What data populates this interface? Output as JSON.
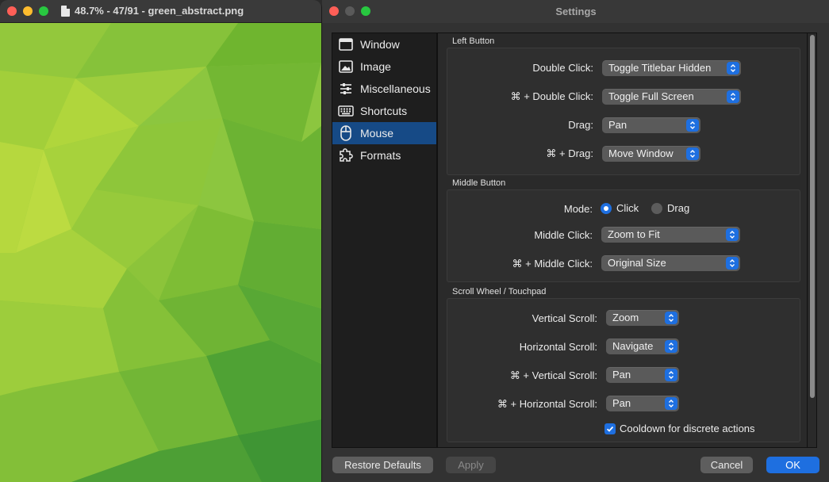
{
  "viewer": {
    "title": "48.7% - 47/91 - green_abstract.png"
  },
  "settings": {
    "title": "Settings",
    "sidebar": [
      {
        "label": "Window",
        "icon": "window-icon"
      },
      {
        "label": "Image",
        "icon": "image-icon"
      },
      {
        "label": "Miscellaneous",
        "icon": "sliders-icon"
      },
      {
        "label": "Shortcuts",
        "icon": "keyboard-icon"
      },
      {
        "label": "Mouse",
        "icon": "mouse-icon",
        "active": true
      },
      {
        "label": "Formats",
        "icon": "puzzle-icon"
      }
    ],
    "left_button": {
      "header": "Left Button",
      "double_click_label": "Double Click:",
      "double_click_value": "Toggle Titlebar Hidden",
      "cmd_double_click_label": "⌘ + Double Click:",
      "cmd_double_click_value": "Toggle Full Screen",
      "drag_label": "Drag:",
      "drag_value": "Pan",
      "cmd_drag_label": "⌘ + Drag:",
      "cmd_drag_value": "Move Window"
    },
    "middle_button": {
      "header": "Middle Button",
      "mode_label": "Mode:",
      "mode_click": "Click",
      "mode_drag": "Drag",
      "mode_selected": "Click",
      "middle_click_label": "Middle Click:",
      "middle_click_value": "Zoom to Fit",
      "cmd_middle_click_label": "⌘ + Middle Click:",
      "cmd_middle_click_value": "Original Size"
    },
    "scroll": {
      "header": "Scroll Wheel / Touchpad",
      "vertical_label": "Vertical Scroll:",
      "vertical_value": "Zoom",
      "horizontal_label": "Horizontal Scroll:",
      "horizontal_value": "Navigate",
      "cmd_vertical_label": "⌘ + Vertical Scroll:",
      "cmd_vertical_value": "Pan",
      "cmd_horizontal_label": "⌘ + Horizontal Scroll:",
      "cmd_horizontal_value": "Pan",
      "cooldown_label": "Cooldown for discrete actions",
      "cooldown_checked": true
    },
    "buttons": {
      "restore": "Restore Defaults",
      "apply": "Apply",
      "cancel": "Cancel",
      "ok": "OK"
    }
  },
  "colors": {
    "accent": "#1e6fe0",
    "sidebar_selected": "#164a86",
    "close": "#ff5f57",
    "minimize": "#febc2e",
    "maximize": "#28c840"
  }
}
